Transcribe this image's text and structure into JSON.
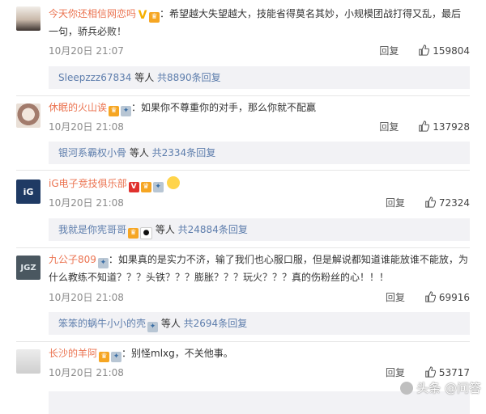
{
  "comments": [
    {
      "username": "今天你还相信网恋吗",
      "text": "：希望越大失望越大，技能省得莫名其妙，小规模团战打得又乱，最后一句，骄兵必败！",
      "time": "10月20日 21:07",
      "reply": "回复",
      "likes": "159804",
      "replies_user": "Sleepzzz67834",
      "replies_mid": " 等人 ",
      "replies_total": "共8890条回复"
    },
    {
      "username": "休眠的火山诶",
      "text": "：如果你不尊重你的对手，那么你就不配赢",
      "time": "10月20日 21:08",
      "reply": "回复",
      "likes": "137928",
      "replies_user": "银河系霸权小骨",
      "replies_mid": " 等人 ",
      "replies_total": "共2334条回复"
    },
    {
      "username": "iG电子竞技俱乐部",
      "text": "",
      "time": "10月20日 21:08",
      "reply": "回复",
      "likes": "72324",
      "replies_user": "我就是你宪哥哥",
      "replies_mid": " 等人 ",
      "replies_total": "共24884条回复"
    },
    {
      "username": "九公子809",
      "text": "：如果真的是实力不济，输了我们也心服口服，但是解说都知道谁能放谁不能放，为什么教练不知道？？？头铁？？？膨胀？？？玩火？？？真的伤粉丝的心！！！",
      "time": "10月20日 21:08",
      "reply": "回复",
      "likes": "69916",
      "replies_user": "笨笨的蜗牛小小的壳",
      "replies_mid": " 等人 ",
      "replies_total": "共2694条回复"
    },
    {
      "username": "长沙的羊阿",
      "text": "：别怪mlxg，不关他事。",
      "time": "10月20日 21:08",
      "reply": "回复",
      "likes": "53717"
    }
  ],
  "avatar_labels": {
    "ig": "iG",
    "jgz": "JGZ"
  },
  "watermark": "头条 @问答",
  "colors": {
    "username": "#eb7350",
    "link": "#5d7dac",
    "replies_bg": "#f2f2f5"
  }
}
